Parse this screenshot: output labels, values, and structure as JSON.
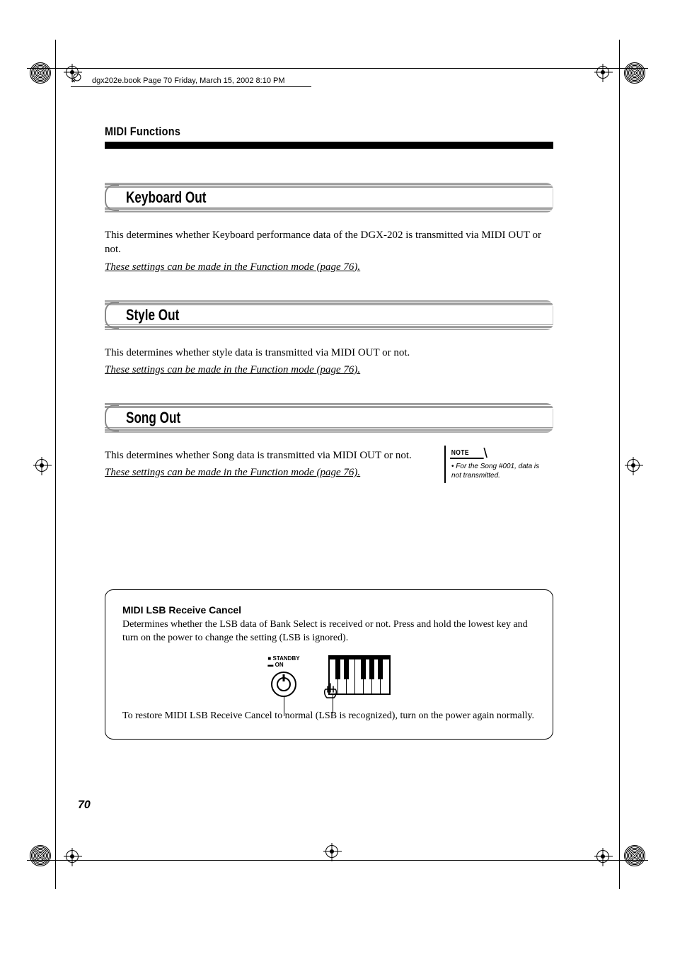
{
  "tagline": "dgx202e.book  Page 70  Friday, March 15, 2002  8:10 PM",
  "chapter_title": "MIDI Functions",
  "sections": [
    {
      "title": "Keyboard Out",
      "body": "This determines whether Keyboard performance data of the DGX-202 is transmitted via MIDI OUT or not.",
      "link": "These settings can be made in the Function mode (page 76)."
    },
    {
      "title": "Style Out",
      "body": "This determines whether style data is transmitted via MIDI OUT or not.",
      "link": "These settings can be made in the Function mode (page 76)."
    },
    {
      "title": "Song Out",
      "body": "This determines whether Song data is transmitted via MIDI OUT or not.",
      "link": "These settings can be made in the Function mode (page 76).",
      "note_label": "NOTE",
      "note_body": "For the Song #001, data is not transmitted."
    }
  ],
  "info_box": {
    "title": "MIDI LSB Receive Cancel",
    "body": "Determines whether the LSB data of Bank Select is received or not.  Press and hold the lowest key and turn on the power to change the setting (LSB is ignored).",
    "switch_standby": "■ STANDBY",
    "switch_on": "▬ ON",
    "footer": "To restore MIDI LSB Receive Cancel to normal (LSB is recognized), turn on the power again normally."
  },
  "page_number": "70"
}
